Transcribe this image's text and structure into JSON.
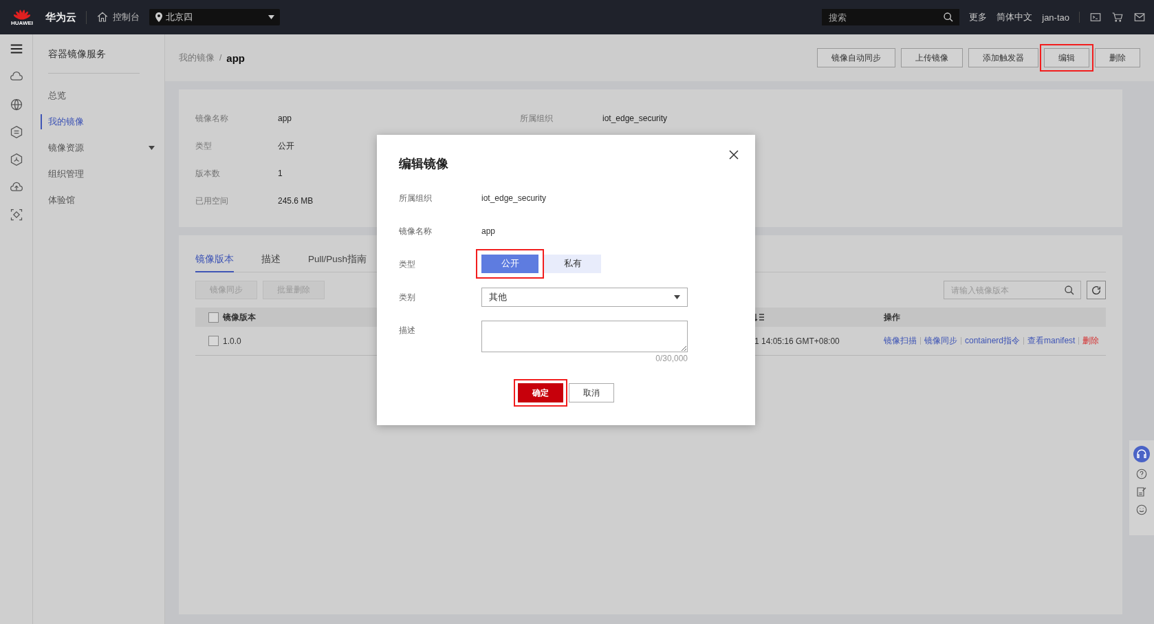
{
  "top_bar": {
    "logo_text": "HUAWEI",
    "brand": "华为云",
    "console": "控制台",
    "region": "北京四",
    "search": {
      "placeholder": "搜索"
    },
    "links": [
      "更多",
      "简体中文",
      "jan-tao"
    ]
  },
  "sidebar": {
    "title": "容器镜像服务",
    "items": [
      {
        "label": "总览",
        "selected": false,
        "expandable": false
      },
      {
        "label": "我的镜像",
        "selected": true,
        "expandable": false
      },
      {
        "label": "镜像资源",
        "selected": false,
        "expandable": true
      },
      {
        "label": "组织管理",
        "selected": false,
        "expandable": false
      },
      {
        "label": "体验馆",
        "selected": false,
        "expandable": false
      }
    ]
  },
  "breadcrumb": [
    "我的镜像",
    "app"
  ],
  "breadcrumb_separator": "/",
  "actions": [
    {
      "label": "镜像自动同步",
      "highlighted": false
    },
    {
      "label": "上传镜像",
      "highlighted": false
    },
    {
      "label": "添加触发器",
      "highlighted": false
    },
    {
      "label": "编辑",
      "highlighted": true
    },
    {
      "label": "删除",
      "highlighted": false
    }
  ],
  "info": {
    "left": [
      {
        "label": "镜像名称",
        "value": "app"
      },
      {
        "label": "类型",
        "value": "公开"
      },
      {
        "label": "版本数",
        "value": "1"
      },
      {
        "label": "已用空间",
        "value": "245.6 MB"
      }
    ],
    "right": [
      {
        "label": "所属组织",
        "value": "iot_edge_security"
      }
    ]
  },
  "tabs": [
    {
      "label": "镜像版本",
      "selected": true
    },
    {
      "label": "描述",
      "selected": false
    },
    {
      "label": "Pull/Push指南",
      "selected": false
    }
  ],
  "toolbar": {
    "buttons": [
      {
        "label": "镜像同步",
        "disabled": true
      },
      {
        "label": "批量删除",
        "disabled": true
      }
    ],
    "search": {
      "placeholder": "请输入镜像版本"
    }
  },
  "table": {
    "select_all_checked": false,
    "columns": {
      "version": "镜像版本",
      "actions": "操作"
    },
    "rows": [
      {
        "checked": false,
        "version": "1.0.0",
        "column_4": "1 14:05:16 GMT+08:00",
        "actions": [
          {
            "label": "镜像扫描",
            "kind": "link"
          },
          {
            "label": "镜像同步",
            "kind": "link"
          },
          {
            "label": "containerd指令",
            "kind": "link"
          },
          {
            "label": "查看manifest",
            "kind": "link"
          },
          {
            "label": "删除",
            "kind": "danger"
          }
        ]
      }
    ]
  },
  "dialog": {
    "title": "编辑镜像",
    "fields": [
      {
        "kind": "text",
        "label": "所属组织",
        "value": "iot_edge_security"
      },
      {
        "kind": "text",
        "label": "镜像名称",
        "value": "app"
      },
      {
        "kind": "toggle",
        "label": "类型",
        "options": [
          {
            "label": "公开",
            "selected": true,
            "highlighted": true
          },
          {
            "label": "私有",
            "selected": false,
            "highlighted": false
          }
        ]
      },
      {
        "kind": "select",
        "label": "类别",
        "value": "其他"
      },
      {
        "kind": "textarea",
        "label": "描述",
        "counter": "0/30,000"
      }
    ],
    "buttons": [
      {
        "label": "确定",
        "kind": "primary",
        "highlighted": true
      },
      {
        "label": "取消",
        "kind": "secondary",
        "highlighted": false
      }
    ]
  }
}
